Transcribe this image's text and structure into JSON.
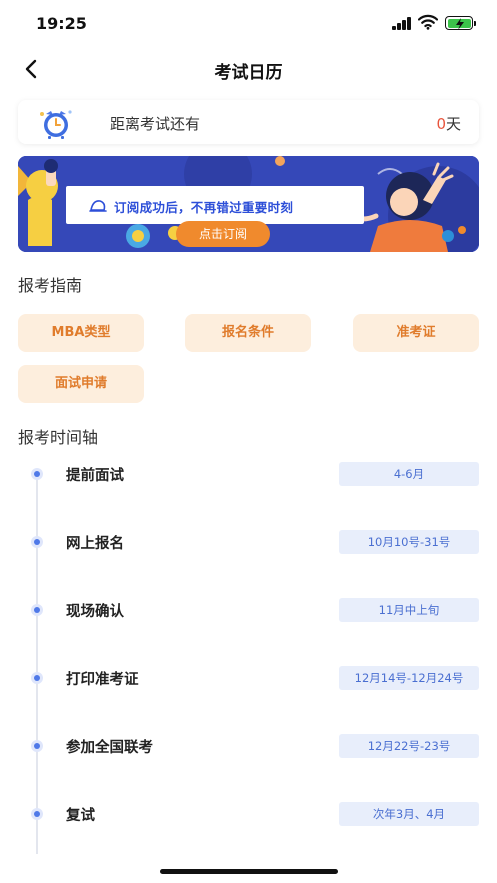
{
  "status_bar": {
    "time": "19:25"
  },
  "nav": {
    "title": "考试日历"
  },
  "countdown": {
    "label": "距离考试还有",
    "value": "0",
    "unit": "天"
  },
  "banner": {
    "text": "订阅成功后，不再错过重要时刻",
    "button": "点击订阅"
  },
  "guide": {
    "title": "报考指南",
    "items": [
      "MBA类型",
      "报名条件",
      "准考证",
      "面试申请"
    ]
  },
  "timeline": {
    "title": "报考时间轴",
    "items": [
      {
        "label": "提前面试",
        "date": "4-6月"
      },
      {
        "label": "网上报名",
        "date": "10月10号-31号"
      },
      {
        "label": "现场确认",
        "date": "11月中上旬"
      },
      {
        "label": "打印准考证",
        "date": "12月14号-12月24号"
      },
      {
        "label": "参加全国联考",
        "date": "12月22号-23号"
      },
      {
        "label": "复试",
        "date": "次年3月、4月"
      }
    ]
  },
  "colors": {
    "accent_orange": "#e07c2c",
    "guide_bg": "#fdeedd",
    "timeline_blue": "#4f79e8",
    "date_bg": "#e8eefb",
    "banner_bg": "#3548b8",
    "countdown_num": "#e8553d"
  }
}
